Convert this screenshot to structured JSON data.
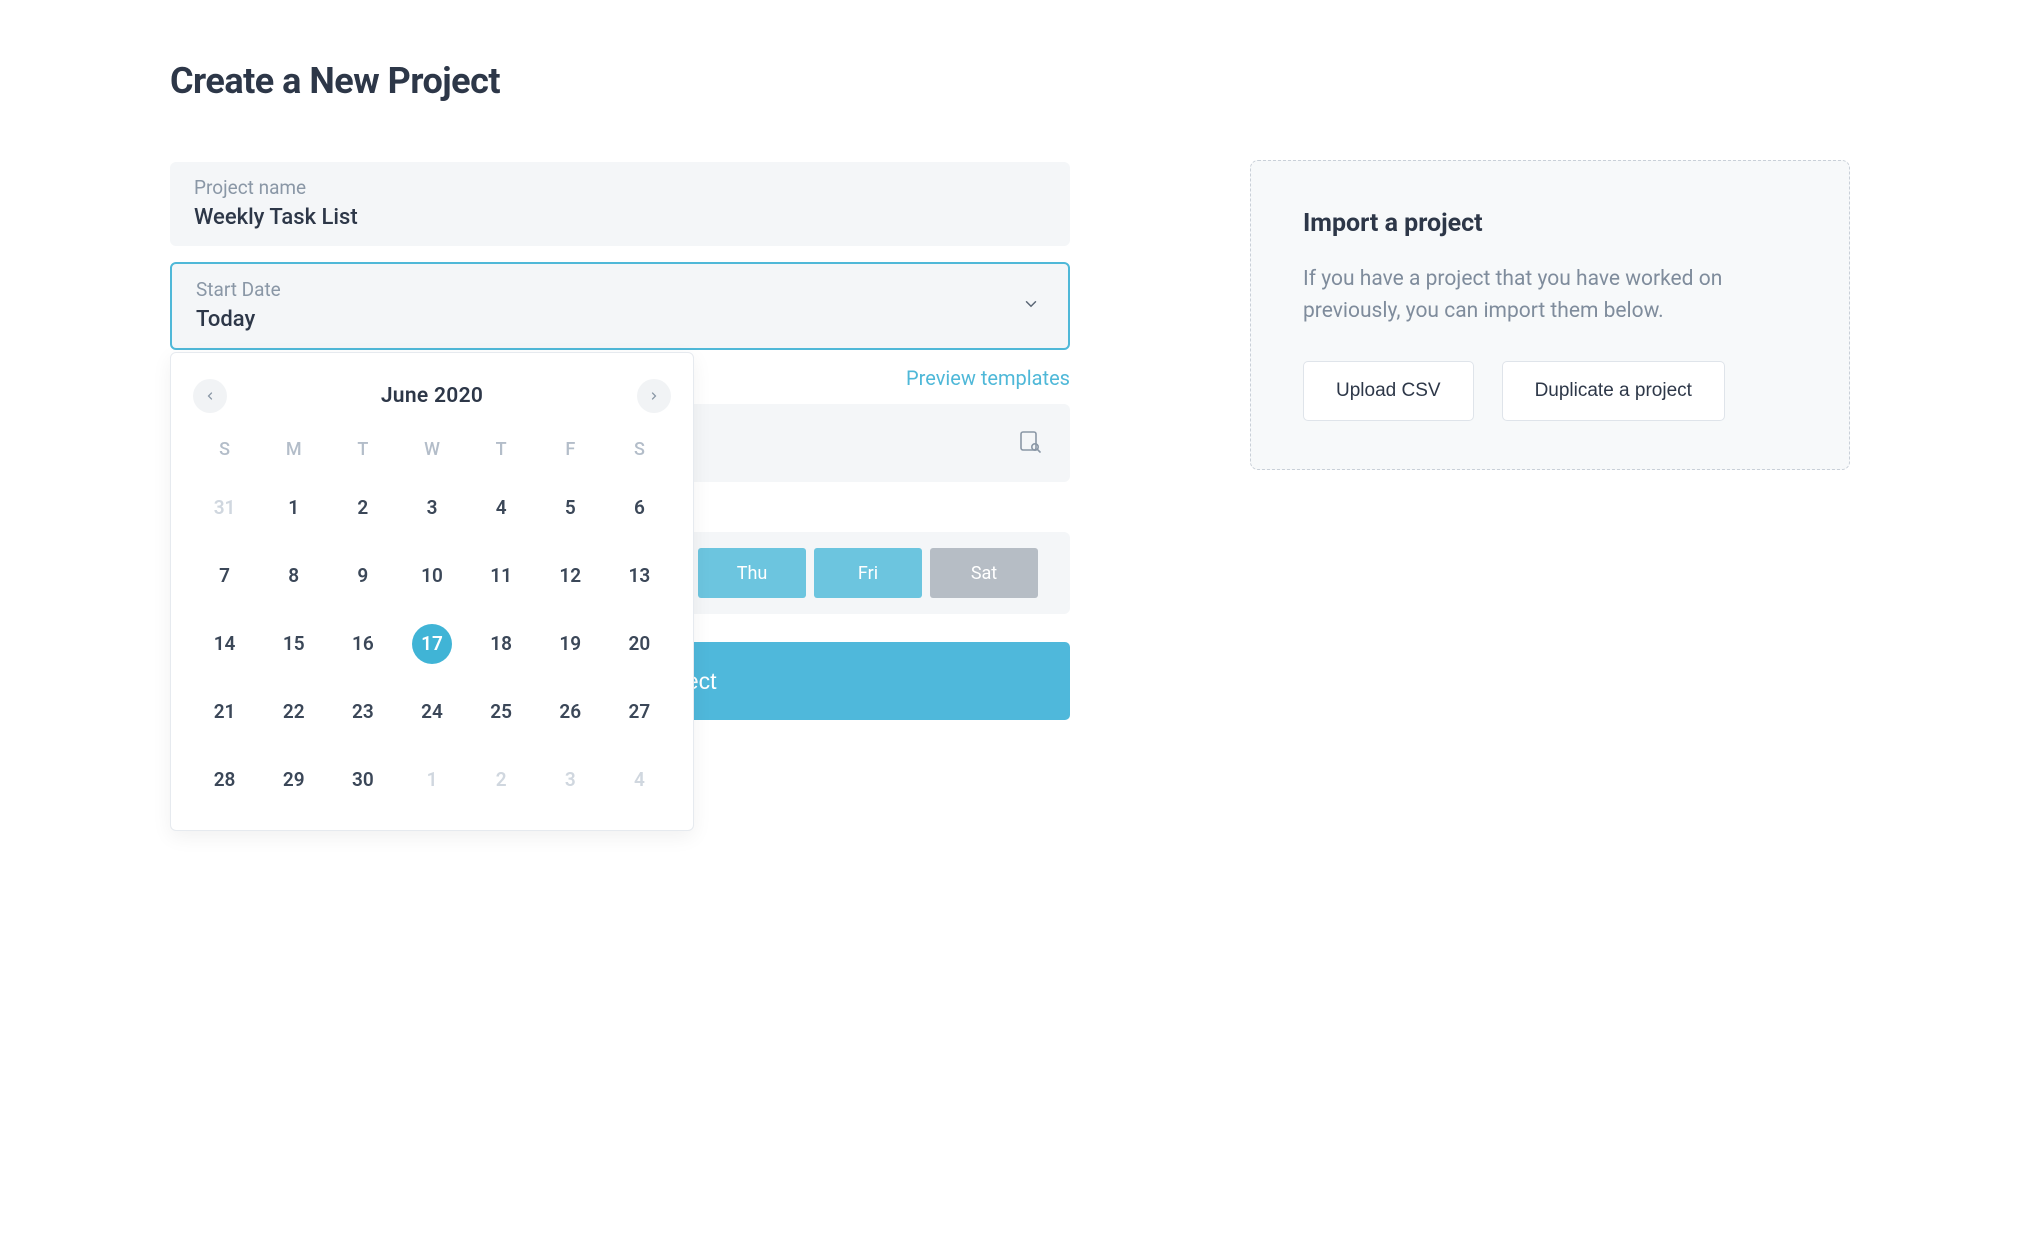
{
  "page_title": "Create a New Project",
  "project_name": {
    "label": "Project name",
    "value": "Weekly Task List"
  },
  "start_date": {
    "label": "Start Date",
    "value": "Today"
  },
  "calendar": {
    "month_label": "June 2020",
    "dow": [
      "S",
      "M",
      "T",
      "W",
      "T",
      "F",
      "S"
    ],
    "weeks": [
      [
        {
          "d": "31",
          "other": true
        },
        {
          "d": "1"
        },
        {
          "d": "2"
        },
        {
          "d": "3"
        },
        {
          "d": "4"
        },
        {
          "d": "5"
        },
        {
          "d": "6"
        }
      ],
      [
        {
          "d": "7"
        },
        {
          "d": "8"
        },
        {
          "d": "9"
        },
        {
          "d": "10"
        },
        {
          "d": "11"
        },
        {
          "d": "12"
        },
        {
          "d": "13"
        }
      ],
      [
        {
          "d": "14"
        },
        {
          "d": "15"
        },
        {
          "d": "16"
        },
        {
          "d": "17",
          "selected": true
        },
        {
          "d": "18"
        },
        {
          "d": "19"
        },
        {
          "d": "20"
        }
      ],
      [
        {
          "d": "21"
        },
        {
          "d": "22"
        },
        {
          "d": "23"
        },
        {
          "d": "24"
        },
        {
          "d": "25"
        },
        {
          "d": "26"
        },
        {
          "d": "27"
        }
      ],
      [
        {
          "d": "28"
        },
        {
          "d": "29"
        },
        {
          "d": "30"
        },
        {
          "d": "1",
          "other": true
        },
        {
          "d": "2",
          "other": true
        },
        {
          "d": "3",
          "other": true
        },
        {
          "d": "4",
          "other": true
        }
      ]
    ]
  },
  "preview_templates_label": "Preview templates",
  "working_days": [
    {
      "label": "Thu",
      "active": true
    },
    {
      "label": "Fri",
      "active": true
    },
    {
      "label": "Sat",
      "active": false
    }
  ],
  "primary_btn_label": "Create new project",
  "import_panel": {
    "title": "Import a project",
    "desc": "If you have a project that you have worked on previously, you can import them below.",
    "upload_btn": "Upload CSV",
    "duplicate_btn": "Duplicate a project"
  }
}
